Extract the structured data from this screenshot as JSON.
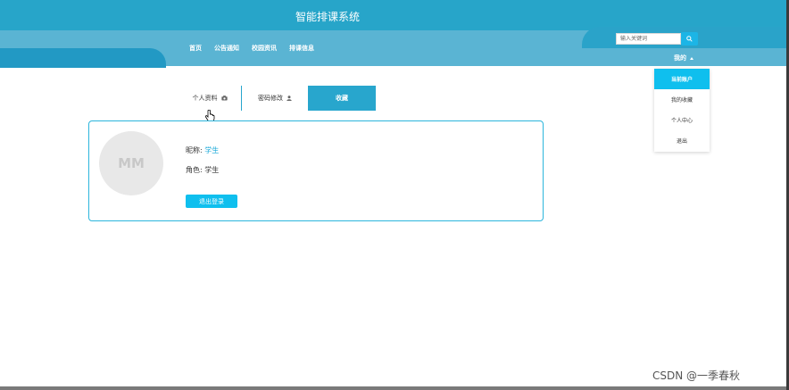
{
  "header": {
    "title": "智能排课系统",
    "nav": [
      "首页",
      "公告通知",
      "校园资讯",
      "排课信息"
    ],
    "search_placeholder": "输入关键词",
    "my_label": "我的"
  },
  "dropdown": {
    "items": [
      "当前账户",
      "我的收藏",
      "个人中心",
      "退出"
    ]
  },
  "tabs": [
    "个人资料",
    "密码修改",
    "收藏"
  ],
  "profile": {
    "avatar_text": "MM",
    "nickname_label": "昵称:",
    "nickname_value": "学生",
    "role_label": "角色:",
    "role_value": "学生",
    "logout_label": "退出登录"
  },
  "watermark": "CSDN @一季春秋",
  "colors": {
    "primary": "#27a5c9",
    "nav": "#5ab4d3",
    "accent": "#0fbfee"
  }
}
